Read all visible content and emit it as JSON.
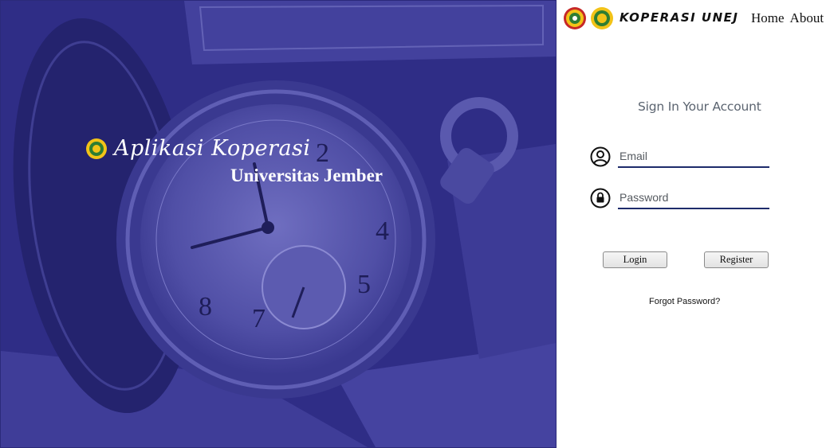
{
  "hero": {
    "title": "Aplikasi Koperasi",
    "subtitle": "Universitas Jember"
  },
  "nav": {
    "brand": "KOPERASI UNEJ",
    "links": [
      "Home",
      "About"
    ]
  },
  "form": {
    "heading": "Sign In Your Account",
    "email_placeholder": "Email",
    "password_placeholder": "Password",
    "login_label": "Login",
    "register_label": "Register",
    "forgot_label": "Forgot Password?"
  },
  "colors": {
    "hero_overlay": "#2f2d86",
    "input_underline": "#1d2b6b",
    "logo_yellow": "#f2c318",
    "logo_green": "#2e7d32",
    "logo_red": "#c62828"
  },
  "icons": [
    "university-seal-icon",
    "koperasi-logo-icon",
    "user-circle-icon",
    "lock-icon"
  ]
}
